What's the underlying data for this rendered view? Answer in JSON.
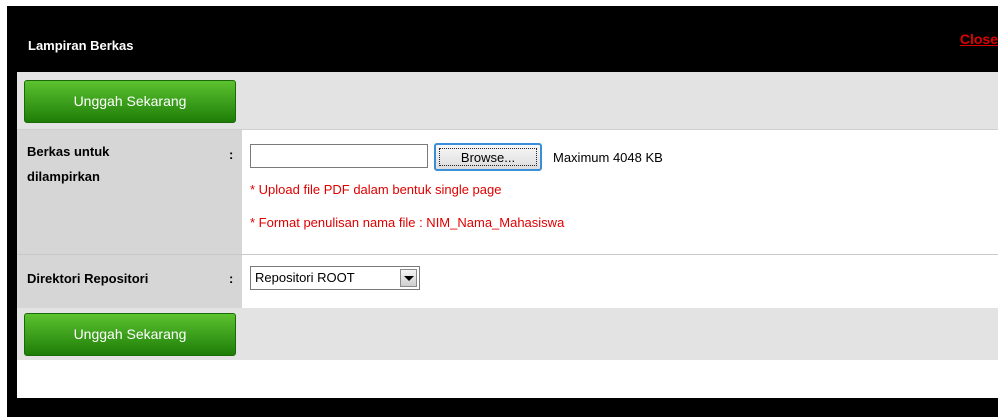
{
  "dialog": {
    "title": "Lampiran Berkas",
    "close_label": "Close"
  },
  "actions": {
    "upload_top_label": "Unggah Sekarang",
    "upload_bottom_label": "Unggah Sekarang"
  },
  "form": {
    "file_field": {
      "label_line1": "Berkas untuk",
      "label_line2": "dilampirkan",
      "colon": ":",
      "value": "",
      "browse_label": "Browse...",
      "max_size": "Maximum 4048 KB",
      "notes": [
        "* Upload file PDF dalam bentuk single page",
        "* Format penulisan nama file : NIM_Nama_Mahasiswa"
      ]
    },
    "directory_field": {
      "label": "Direktori Repositori",
      "colon": ":",
      "selected": "Repositori ROOT"
    }
  },
  "colors": {
    "accent_green": "#3da01c",
    "warning_red": "#e00000",
    "titlebar": "#000000"
  }
}
